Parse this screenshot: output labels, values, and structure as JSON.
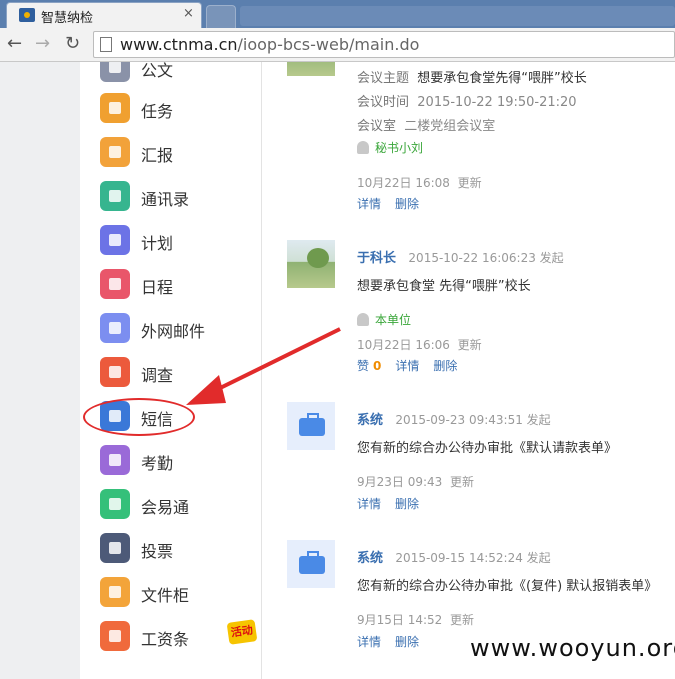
{
  "browser": {
    "tab_title": "智慧纳检",
    "tab_close": "×",
    "url_domain": "www.ctnma.cn",
    "url_path": "/ioop-bcs-web/main.do"
  },
  "sidebar": {
    "items": [
      {
        "label": "公文",
        "icon": "document-icon",
        "color": "#8a92a8"
      },
      {
        "label": "任务",
        "icon": "task-icon",
        "color": "#f0a030"
      },
      {
        "label": "汇报",
        "icon": "report-icon",
        "color": "#f2a23a"
      },
      {
        "label": "通讯录",
        "icon": "contacts-icon",
        "color": "#36b58f"
      },
      {
        "label": "计划",
        "icon": "plan-icon",
        "color": "#6c73e6"
      },
      {
        "label": "日程",
        "icon": "calendar-icon",
        "color": "#e9566a"
      },
      {
        "label": "外网邮件",
        "icon": "mail-icon",
        "color": "#7c8ef0"
      },
      {
        "label": "调查",
        "icon": "survey-icon",
        "color": "#ec5a3c"
      },
      {
        "label": "短信",
        "icon": "sms-icon",
        "color": "#3a78d8"
      },
      {
        "label": "考勤",
        "icon": "attendance-icon",
        "color": "#9a6ad8"
      },
      {
        "label": "会易通",
        "icon": "phone-icon",
        "color": "#35c07a"
      },
      {
        "label": "投票",
        "icon": "vote-icon",
        "color": "#4d5a78"
      },
      {
        "label": "文件柜",
        "icon": "cabinet-icon",
        "color": "#f3a43a"
      },
      {
        "label": "工资条",
        "icon": "salary-icon",
        "color": "#f06a3c"
      }
    ],
    "activity_badge": "活动"
  },
  "feed": {
    "item1": {
      "topic_label": "会议主题",
      "topic": "想要承包食堂先得“喂胖”校长",
      "time_label": "会议时间",
      "time": "2015-10-22 19:50-21:20",
      "room_label": "会议室",
      "room": "二楼党组会议室",
      "scope": "秘书小刘",
      "updated": "10月22日 16:08",
      "updated_label": "更新",
      "details": "详情",
      "delete": "删除"
    },
    "item2": {
      "author": "于科长",
      "posted": "2015-10-22 16:06:23 发起",
      "content": "想要承包食堂 先得“喂胖”校长",
      "scope": "本单位",
      "updated": "10月22日 16:06",
      "updated_label": "更新",
      "like": "赞",
      "like_count": "0",
      "details": "详情",
      "delete": "删除"
    },
    "item3": {
      "author": "系统",
      "posted": "2015-09-23 09:43:51 发起",
      "content": "您有新的综合办公待办审批《默认请款表单》",
      "updated": "9月23日 09:43",
      "updated_label": "更新",
      "details": "详情",
      "delete": "删除"
    },
    "item4": {
      "author": "系统",
      "posted": "2015-09-15 14:52:24 发起",
      "content": "您有新的综合办公待办审批《(复件) 默认报销表单》",
      "updated": "9月15日 14:52",
      "updated_label": "更新",
      "details": "详情",
      "delete": "删除"
    }
  },
  "watermark": "www.wooyun.org",
  "annotation_color": "#e12b2b"
}
